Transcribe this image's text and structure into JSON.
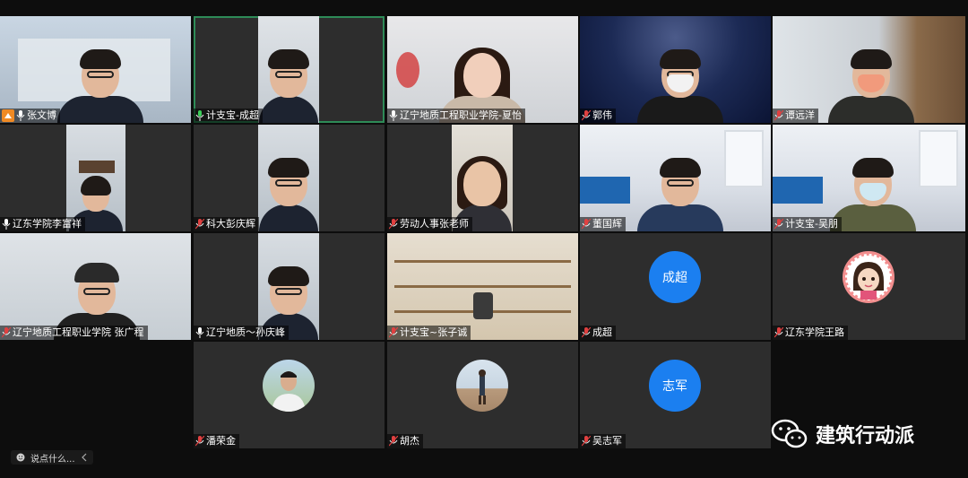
{
  "participants": [
    {
      "name": "张文博",
      "host": true
    },
    {
      "name": "计支宝-成超"
    },
    {
      "name": "辽宁地质工程职业学院-夏怡"
    },
    {
      "name": "郭伟"
    },
    {
      "name": "谭远洋"
    },
    {
      "name": "辽东学院李富祥"
    },
    {
      "name": "科大彭庆辉"
    },
    {
      "name": "劳动人事张老师"
    },
    {
      "name": "董国辉"
    },
    {
      "name": "计支宝-吴朋"
    },
    {
      "name": "辽宁地质工程职业学院 张广程"
    },
    {
      "name": "辽宁地质～孙庆峰"
    },
    {
      "name": "计支宝~张子诚"
    },
    {
      "name": "成超",
      "avatar_text": "成超",
      "avatar_color": "#1b7ff0"
    },
    {
      "name": "辽东学院王路"
    },
    {
      "name": "潘荣金"
    },
    {
      "name": "胡杰"
    },
    {
      "name": "吴志军",
      "avatar_text": "志军",
      "avatar_color": "#1b7ff0"
    }
  ],
  "chat_input": {
    "placeholder": "说点什么..."
  },
  "watermark": {
    "text": "建筑行动派",
    "icon": "wechat-icon"
  },
  "colors": {
    "active_speaker": "#2e8b57",
    "avatar_blue": "#1b7ff0",
    "host_badge": "#f08a24"
  }
}
